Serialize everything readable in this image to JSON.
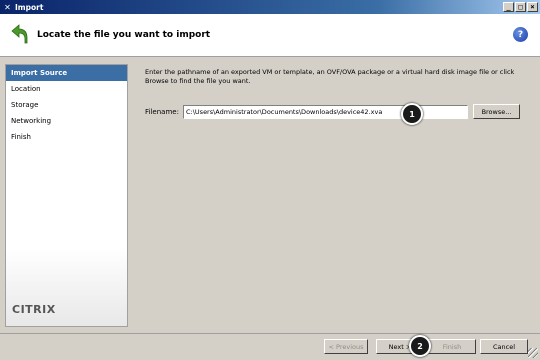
{
  "window": {
    "title": "Import",
    "min": "_",
    "max": "□",
    "close": "×"
  },
  "header": {
    "title": "Locate the file you want to import",
    "help": "?"
  },
  "sidebar": {
    "items": [
      {
        "label": "Import Source"
      },
      {
        "label": "Location"
      },
      {
        "label": "Storage"
      },
      {
        "label": "Networking"
      },
      {
        "label": "Finish"
      }
    ],
    "logo": "CITRIX"
  },
  "main": {
    "description": "Enter the pathname of an exported VM or template, an OVF/OVA package or a virtual hard disk image file or click Browse to find the file you want.",
    "filename_label": "Filename:",
    "filename_value": "C:\\Users\\Administrator\\Documents\\Downloads\\device42.xva",
    "browse_label": "Browse..."
  },
  "footer": {
    "previous_label": "< Previous",
    "next_label": "Next >",
    "finish_label": "Finish",
    "cancel_label": "Cancel"
  },
  "markers": {
    "one": "1",
    "two": "2"
  },
  "colors": {
    "accent": "#3a6ea5",
    "titlebar": "#0a246a"
  }
}
